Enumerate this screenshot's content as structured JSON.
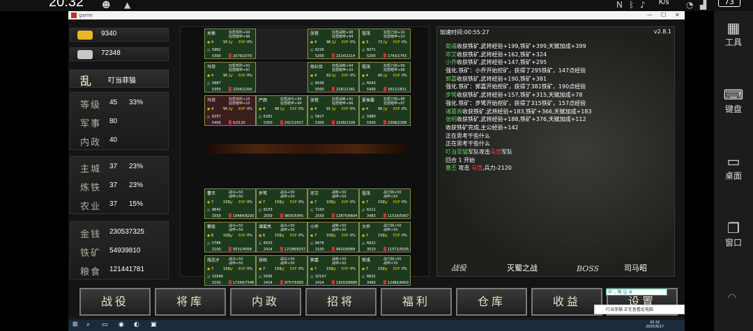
{
  "statusbar": {
    "time": "20:32",
    "net": "K/s",
    "battery": "73"
  },
  "window": {
    "title": "game",
    "min": "—",
    "max": "☐",
    "close": "✕"
  },
  "left": {
    "gold": "9340",
    "silver": "72348",
    "seal": "乱",
    "name": "叮当菲猫",
    "stats1": [
      {
        "label": "等级",
        "v1": "45",
        "v2": "33%"
      },
      {
        "label": "军事",
        "v1": "80",
        "v2": ""
      },
      {
        "label": "内政",
        "v1": "40",
        "v2": ""
      }
    ],
    "stats2": [
      {
        "label": "主城",
        "v1": "37",
        "v2": "23%"
      },
      {
        "label": "炼铁",
        "v1": "37",
        "v2": "23%"
      },
      {
        "label": "农业",
        "v1": "37",
        "v2": "15%"
      }
    ],
    "stats3": [
      {
        "label": "金钱",
        "v1": "230537325"
      },
      {
        "label": "铁矿",
        "v1": "54939810"
      },
      {
        "label": "粮食",
        "v1": "121441781"
      }
    ]
  },
  "enemy": [
    {
      "name": "关索",
      "s1": "狂怒攻防+94",
      "s2": "狂怒暗甲+96",
      "lv": "4",
      "lvl": "93",
      "pct": "0%",
      "a": "5962",
      "b": "5300",
      "hp": "2079/2079"
    },
    null,
    {
      "name": "张苞",
      "s1": "狂怒战枪+98",
      "s2": "狂怒暗甲+94",
      "lv": "4",
      "lvl": "96",
      "pct": "0%",
      "a": "6216",
      "b": "5200",
      "hp": "2214/2214"
    },
    {
      "name": "祖茂",
      "s1": "狂怒刀剑+10",
      "s2": "狂怒暗甲+10",
      "lv": "3",
      "lvl": "72",
      "pct": "0%",
      "a": "6071",
      "b": "5200",
      "hp": "1743/1743"
    },
    {
      "name": "马岱",
      "s1": "狂怒攻防+92",
      "s2": "狂怒暗甲+97",
      "lv": "4",
      "lvl": "95",
      "pct": "0%",
      "a": "5887",
      "b": "5350",
      "hp": "2204/2204"
    },
    null,
    {
      "name": "胡丘俭",
      "s1": "狂怒战枪+94",
      "s2": "狂怒暗甲+10",
      "lv": "4",
      "lvl": "92",
      "pct": "0%",
      "a": "6036",
      "b": "5500",
      "hp": "2181/2181"
    },
    {
      "name": "祖茂",
      "s1": "狂怒刀剑+99",
      "s2": "狂怒暗甲+98",
      "lv": "4",
      "lvl": "90",
      "pct": "0%",
      "a": "6043",
      "b": "5400",
      "hp": "1811/1811"
    },
    {
      "name": "马岱",
      "s1": "狂怒攻防+10",
      "s2": "狂怒暗甲+10",
      "lv": "4",
      "lvl": "95",
      "pct": "0%",
      "a": "6257",
      "b": "5400",
      "hp": "0/2120",
      "red": true
    },
    {
      "name": "严颜",
      "s1": "狂怒战弓+99",
      "s2": "狂怒暗甲+94",
      "lv": "4",
      "lvl": "98",
      "pct": "0%",
      "a": "6281",
      "b": "5350",
      "hp": "2417/2417"
    },
    {
      "name": "张苞",
      "s1": "狂怒战枪+91",
      "s2": "狂怒暗甲+96",
      "lv": "4",
      "lvl": "91",
      "pct": "0%",
      "a": "5827",
      "b": "5300",
      "hp": "2109/2109"
    },
    {
      "name": "夏侯霸",
      "s1": "狂怒刀剑+98",
      "s2": "狂怒暗甲+97",
      "lv": "4",
      "lvl": "96",
      "pct": "0%",
      "a": "5980",
      "b": "5300",
      "hp": "2308/2308"
    }
  ],
  "ally": [
    {
      "name": "曹丕",
      "s1": "战马+50",
      "s2": "战甲+50",
      "lv": "7",
      "lvl": "150",
      "pct": "0%",
      "a": "9642",
      "b": "2559",
      "hp": "19484/8293"
    },
    {
      "name": "步骘",
      "s1": "战马+50",
      "s2": "战甲+50",
      "lv": "7",
      "lvl": "150",
      "pct": "0%",
      "a": "6153",
      "b": "2559",
      "hp": "9835/5045"
    },
    {
      "name": "邓艾",
      "s1": "战枪+50",
      "s2": "战甲+50",
      "lv": "7",
      "lvl": "100",
      "pct": "0%",
      "a": "7243",
      "b": "2559",
      "hp": "12875/6604"
    },
    {
      "name": "祖茂",
      "s1": "战刀剑+50",
      "s2": "战甲+50",
      "lv": "7",
      "lvl": "150",
      "pct": "0%",
      "a": "6211",
      "b": "3483",
      "hp": "11516/5907"
    },
    {
      "name": "蔡琰",
      "s1": "战马+50",
      "s2": "战甲+50",
      "lv": "6",
      "lvl": "100",
      "pct": "0%",
      "a": "5786",
      "b": "2100",
      "hp": "9531/4058"
    },
    {
      "name": "诸葛亮",
      "s1": "战马+50",
      "s2": "战甲+50",
      "lv": "6",
      "lvl": "150",
      "pct": "0%",
      "a": "6533",
      "b": "2414",
      "hp": "12198/6257"
    },
    {
      "name": "小乔",
      "s1": "战枪+50",
      "s2": "战甲+50",
      "lv": "7",
      "lvl": "100",
      "pct": "0%",
      "a": "6676",
      "b": "2100",
      "hp": "9920/9089"
    },
    {
      "name": "大乔",
      "s1": "战刀剑+50",
      "s2": "战甲+50",
      "lv": "7",
      "lvl": "150",
      "pct": "0%",
      "a": "6922",
      "b": "3010",
      "hp": "11571/5935"
    },
    {
      "name": "戏志才",
      "s1": "战马+50",
      "s2": "战甲+50",
      "lv": "7",
      "lvl": "150",
      "pct": "0%",
      "a": "10546",
      "b": "2100",
      "hp": "17264/7348"
    },
    {
      "name": "张昭",
      "s1": "战马+50",
      "s2": "战甲+50",
      "lv": "7",
      "lvl": "150",
      "pct": "0%",
      "a": "5595",
      "b": "2414",
      "hp": "9757/5005"
    },
    {
      "name": "郭嘉",
      "s1": "战枪+50",
      "s2": "战甲+50",
      "lv": "7",
      "lvl": "150",
      "pct": "0%",
      "a": "10147",
      "b": "2414",
      "hp": "13033/6685"
    },
    {
      "name": "荀彧",
      "s1": "战刀剑+50",
      "s2": "战甲+50",
      "lv": "7",
      "lvl": "150",
      "pct": "0%",
      "a": "6825",
      "b": "3483",
      "hp": "12482/6402"
    }
  ],
  "log": {
    "accel": "加速时间:00:55:27",
    "version": "v2.8.1",
    "lines": [
      [
        {
          "t": "荀彧",
          "c": "g"
        },
        {
          "t": "收获铁矿,武将经验+199,铁矿+399,天赋加成+399"
        }
      ],
      [
        {
          "t": "邓艾",
          "c": "g"
        },
        {
          "t": "收获铁矿,武将经验+162,铁矿+324"
        }
      ],
      [
        {
          "t": "小乔",
          "c": "g"
        },
        {
          "t": "收获铁矿,武将经验+147,铁矿+295"
        }
      ],
      [
        {
          "t": "强化.铁矿：小乔开始挖矿，获得了295铁矿，147点经验"
        }
      ],
      [
        {
          "t": "郭嘉",
          "c": "g"
        },
        {
          "t": "收获铁矿,武将经验+190,铁矿+381"
        }
      ],
      [
        {
          "t": "强化.铁矿：郭嘉开始挖矿，获得了381铁矿，190点经验"
        }
      ],
      [
        {
          "t": "步骘",
          "c": "g"
        },
        {
          "t": "收获铁矿,武将经验+157,铁矿+315,天赋加成+78"
        }
      ],
      [
        {
          "t": "强化.铁矿：步骘开始挖矿，获得了315铁矿，157点经验"
        }
      ],
      [
        {
          "t": "诸葛亮",
          "c": "g"
        },
        {
          "t": "收获铁矿,武将经验+183,铁矿+366,天赋加成+183"
        }
      ],
      [
        {
          "t": "张昭",
          "c": "g"
        },
        {
          "t": "收获铁矿,武将经验+188,铁矿+376,天赋加成+112"
        }
      ],
      [
        {
          "t": "收获铁矿完成,主公经验+142"
        }
      ],
      [
        {
          "t": "正在思考干些什么"
        }
      ],
      [
        {
          "t": "正在思考干些什么"
        }
      ],
      [
        {
          "t": "叮当菲猫",
          "c": "g"
        },
        {
          "t": "军队攻击"
        },
        {
          "t": "马岱",
          "c": "r"
        },
        {
          "t": "军队"
        }
      ],
      [
        {
          "t": "回合 1 开始"
        }
      ],
      [
        {
          "t": "曹丕",
          "c": "g"
        },
        {
          "t": " 攻击 "
        },
        {
          "t": "马岱",
          "c": "r"
        },
        {
          "t": ",兵力-2120"
        }
      ]
    ],
    "bottom": [
      "战役",
      "灭蜀之战",
      "BOSS",
      "司马昭"
    ]
  },
  "buttons": [
    "战役",
    "将库",
    "内政",
    "招将",
    "福利",
    "仓库",
    "收益",
    "设置"
  ],
  "ime": "中 ·, 简 ☺ ⚙",
  "notif": "叮当菲猫  正在查看此电脑",
  "taskbar": {
    "clock1": "20:32",
    "clock2": "2025/9/17"
  },
  "sidebar": [
    {
      "icon": "▦",
      "label": "工具"
    },
    {
      "icon": "⌨",
      "label": "键盘"
    },
    {
      "icon": "▭",
      "label": "桌面"
    },
    {
      "icon": "❐",
      "label": "窗口"
    }
  ]
}
